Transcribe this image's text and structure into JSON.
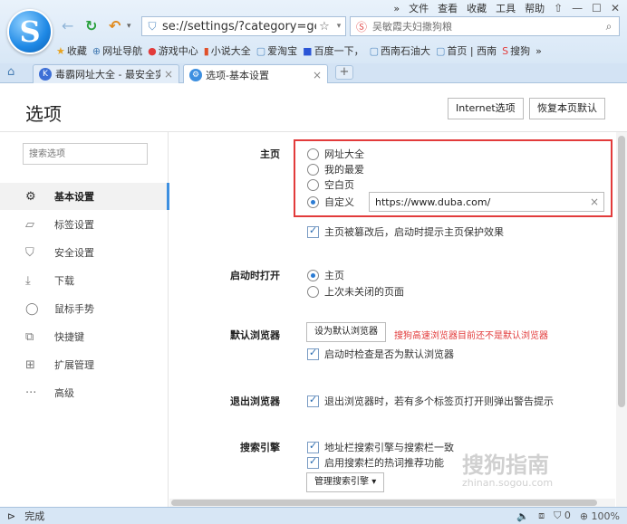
{
  "menu": {
    "more": "»",
    "file": "文件",
    "view": "查看",
    "favorites": "收藏",
    "tools": "工具",
    "help": "帮助"
  },
  "nav": {
    "url": "se://settings/?category=ge",
    "search_placeholder": "吴敏霞夫妇撒狗粮"
  },
  "bookmarks": [
    {
      "label": "收藏",
      "icon": "★",
      "color": "#e8a320"
    },
    {
      "label": "网址导航",
      "icon": "⊕",
      "color": "#4a7fb5"
    },
    {
      "label": "游戏中心",
      "icon": "●",
      "color": "#e23b3b"
    },
    {
      "label": "小说大全",
      "icon": "▮",
      "color": "#e0502a"
    },
    {
      "label": "爱淘宝",
      "icon": "▢",
      "color": "#5a8fc4"
    },
    {
      "label": "百度一下，",
      "icon": "■",
      "color": "#2b55d6"
    },
    {
      "label": "西南石油大",
      "icon": "▢",
      "color": "#5a8fc4"
    },
    {
      "label": "首页 | 西南",
      "icon": "▢",
      "color": "#5a8fc4"
    },
    {
      "label": "搜狗",
      "icon": "S",
      "color": "#e23b3b"
    },
    {
      "label": "»",
      "icon": "",
      "color": "#555"
    }
  ],
  "tabs": [
    {
      "label": "毒霸网址大全 - 最安全实",
      "icon": "K",
      "icon_color": "#3d6fd6"
    },
    {
      "label": "选项-基本设置",
      "icon": "⚙",
      "icon_color": "#3d8fe0"
    }
  ],
  "page": {
    "title": "选项",
    "ie_button": "Internet选项",
    "reset_button": "恢复本页默认"
  },
  "sidebar": {
    "search_placeholder": "搜索选项",
    "items": [
      {
        "label": "基本设置",
        "icon": "⚙",
        "icon_name": "gear-icon",
        "active": true
      },
      {
        "label": "标签设置",
        "icon": "▱",
        "icon_name": "tab-icon",
        "active": false
      },
      {
        "label": "安全设置",
        "icon": "⛉",
        "icon_name": "shield-icon",
        "active": false
      },
      {
        "label": "下载",
        "icon": "⤓",
        "icon_name": "download-icon",
        "active": false
      },
      {
        "label": "鼠标手势",
        "icon": "◯",
        "icon_name": "mouse-icon",
        "active": false
      },
      {
        "label": "快捷键",
        "icon": "⧉",
        "icon_name": "shortcut-icon",
        "active": false
      },
      {
        "label": "扩展管理",
        "icon": "⊞",
        "icon_name": "extension-icon",
        "active": false
      },
      {
        "label": "高级",
        "icon": "···",
        "icon_name": "more-icon",
        "active": false
      }
    ]
  },
  "settings": {
    "homepage": {
      "label": "主页",
      "options": [
        {
          "label": "网址大全",
          "checked": false
        },
        {
          "label": "我的最爱",
          "checked": false
        },
        {
          "label": "空白页",
          "checked": false
        },
        {
          "label": "自定义",
          "checked": true
        }
      ],
      "custom_url": "https://www.duba.com/",
      "protect_label": "主页被篡改后，启动时提示主页保护效果"
    },
    "startup": {
      "label": "启动时打开",
      "options": [
        {
          "label": "主页",
          "checked": true
        },
        {
          "label": "上次未关闭的页面",
          "checked": false
        }
      ]
    },
    "default_browser": {
      "label": "默认浏览器",
      "button": "设为默认浏览器",
      "warning": "搜狗高速浏览器目前还不是默认浏览器",
      "check_label": "启动时检查是否为默认浏览器"
    },
    "exit": {
      "label": "退出浏览器",
      "check_label": "退出浏览器时，若有多个标签页打开则弹出警告提示"
    },
    "search_engine": {
      "label": "搜索引擎",
      "check1": "地址栏搜索引擎与搜索栏一致",
      "check2": "启用搜索栏的热词推荐功能",
      "manage_button": "管理搜索引擎"
    }
  },
  "watermark": {
    "main": "搜狗指南",
    "sub": "zhinan.sogou.com"
  },
  "status": {
    "text": "完成",
    "zoom": "100%",
    "count": "0"
  }
}
